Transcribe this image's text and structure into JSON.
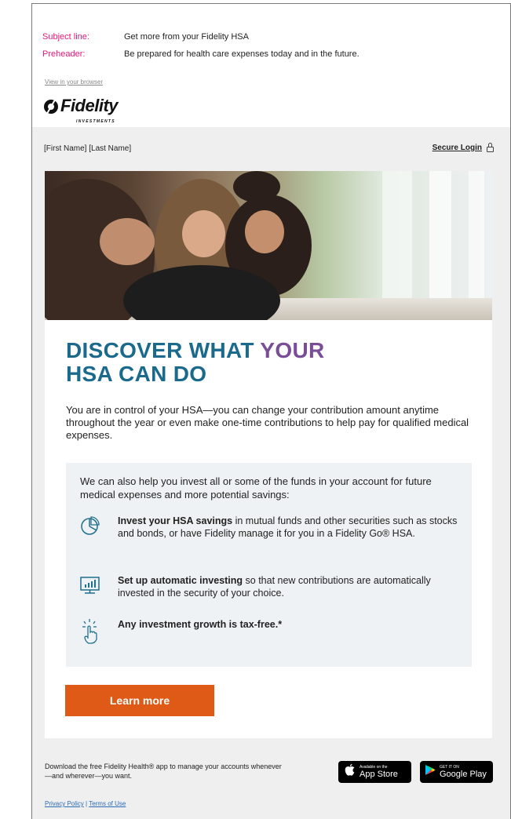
{
  "email_meta": {
    "subject_key": "Subject line:",
    "subject_value": "Get more from your Fidelity HSA",
    "preheader_key": "Preheader:",
    "preheader_value": "Be prepared for health care expenses today and in the future."
  },
  "header": {
    "view_in_browser": "View in your browser",
    "logo_word": "Fidelity",
    "logo_sub": "INVESTMENTS",
    "greeting": "[First Name] [Last Name]",
    "secure_login": "Secure Login"
  },
  "main": {
    "headline_line1_a": "DISCOVER WHAT ",
    "headline_line1_b": "YOUR",
    "headline_line2": "HSA CAN DO",
    "intro": "You are in control of your HSA—you can change your contribution amount anytime throughout the year or even make one-time contributions to help pay for qualified medical expenses.",
    "box_intro": "We can also help you invest all or some of the funds in your account for future medical expenses and more potential savings:",
    "items": [
      {
        "bold": "Invest your HSA savings",
        "rest": " in mutual funds and other securities such as stocks and bonds, or have Fidelity manage it for you in a Fidelity Go® HSA.",
        "icon": "pie-chart-icon"
      },
      {
        "bold": "Set up automatic investing",
        "rest": " so that new contributions are automatically invested in the security of your choice.",
        "icon": "monitor-chart-icon"
      },
      {
        "bold": "Any investment growth is tax-free.*",
        "rest": "",
        "icon": "tap-hand-icon"
      }
    ],
    "cta": "Learn more"
  },
  "footer": {
    "app_text": "Download the free Fidelity Health® app to manage your accounts whenever—and wherever—you want.",
    "appstore_small": "Available on the",
    "appstore_big": "App Store",
    "googleplay_small": "GET IT ON",
    "googleplay_big": "Google Play",
    "privacy": "Privacy Policy",
    "sep": " | ",
    "terms": "Terms of Use"
  },
  "colors": {
    "pink_label": "#e2197a",
    "headline_teal": "#1b6a8c",
    "headline_purple": "#7a4e97",
    "cta_orange": "#e05a17",
    "icon_blue": "#1f6f8e"
  }
}
